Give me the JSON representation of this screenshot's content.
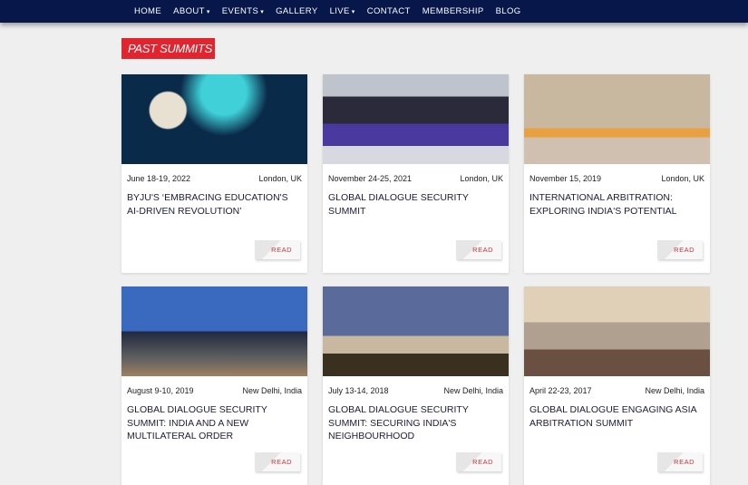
{
  "nav": {
    "items": [
      {
        "label": "HOME"
      },
      {
        "label": "ABOUT",
        "dropdown": true
      },
      {
        "label": "EVENTS",
        "dropdown": true
      },
      {
        "label": "GALLERY"
      },
      {
        "label": "LIVE",
        "dropdown": true
      },
      {
        "label": "CONTACT"
      },
      {
        "label": "MEMBERSHIP"
      },
      {
        "label": "BLOG"
      }
    ]
  },
  "section_title": "PAST SUMMITS",
  "read_label": "READ",
  "cards": [
    {
      "date": "June 18-19, 2022",
      "location": "London, UK",
      "title": "BYJU'S ‘EMBRACING EDUCATION'S AI-DRIVEN REVOLUTION’"
    },
    {
      "date": "November 24-25, 2021",
      "location": "London, UK",
      "title": "GLOBAL DIALOGUE SECURITY SUMMIT"
    },
    {
      "date": "November 15, 2019",
      "location": "London, UK",
      "title": "INTERNATIONAL ARBITRATION: EXPLORING INDIA'S POTENTIAL"
    },
    {
      "date": "August 9-10, 2019",
      "location": "New Delhi, India",
      "title": "GLOBAL DIALOGUE SECURITY SUMMIT: INDIA AND A NEW MULTILATERAL ORDER"
    },
    {
      "date": "July 13-14, 2018",
      "location": "New Delhi, India",
      "title": "GLOBAL DIALOGUE SECURITY SUMMIT: SECURING INDIA'S NEIGHBOURHOOD"
    },
    {
      "date": "April 22-23, 2017",
      "location": "New Delhi, India",
      "title": "GLOBAL DIALOGUE ENGAGING ASIA ARBITRATION SUMMIT"
    }
  ]
}
